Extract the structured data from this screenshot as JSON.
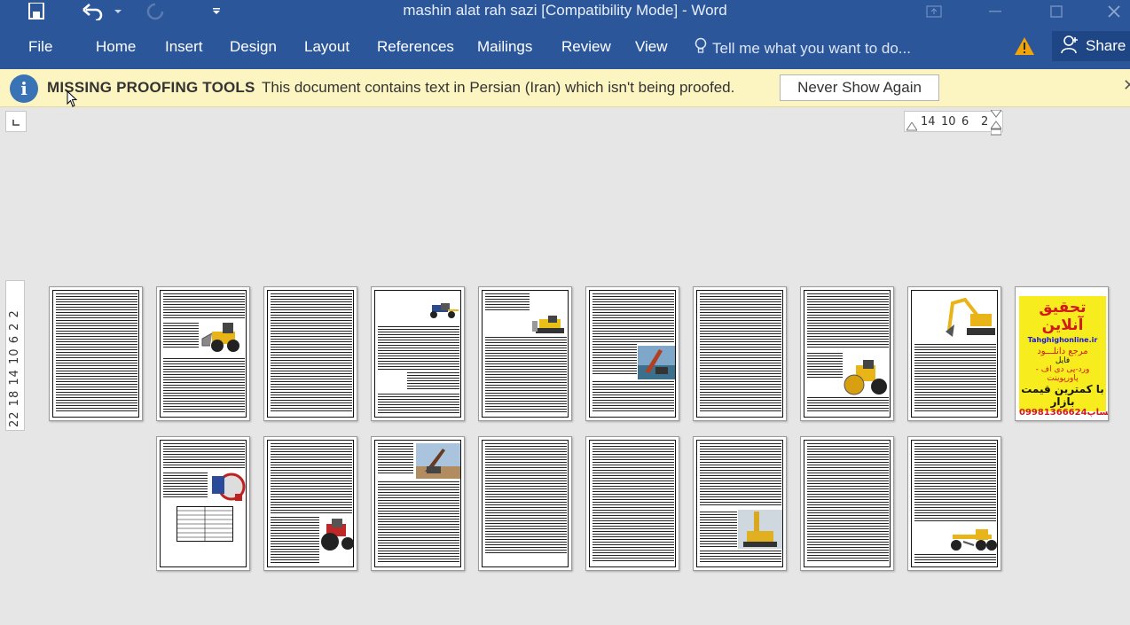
{
  "window": {
    "title": "mashin alat rah sazi [Compatibility Mode] - Word"
  },
  "ribbon": {
    "tabs": [
      "File",
      "Home",
      "Insert",
      "Design",
      "Layout",
      "References",
      "Mailings",
      "Review",
      "View"
    ],
    "tell_me_placeholder": "Tell me what you want to do...",
    "share_label": "Share"
  },
  "message_bar": {
    "title": "MISSING PROOFING TOOLS",
    "text": "This document contains text in Persian (Iran) which isn't being proofed.",
    "button_label": "Never Show Again"
  },
  "rulers": {
    "horizontal": [
      "14",
      "10",
      "6",
      "2"
    ],
    "vertical": "22 18 14 10 6 2 2"
  },
  "ad_page": {
    "line1": "تحقیق آنلاین",
    "line2": "Tahghighonline.ir",
    "line3": "مرجع دانلـــود",
    "line4": "فایل",
    "line5": "ورد-پی دی اف - پاورپوینت",
    "line6": "با کمترین قیمت بازار",
    "line7": "09981366624واتساپ"
  },
  "colors": {
    "ribbon": "#2b579a",
    "message_bar": "#fdf5c1",
    "ad_background": "#f6ec1e"
  }
}
